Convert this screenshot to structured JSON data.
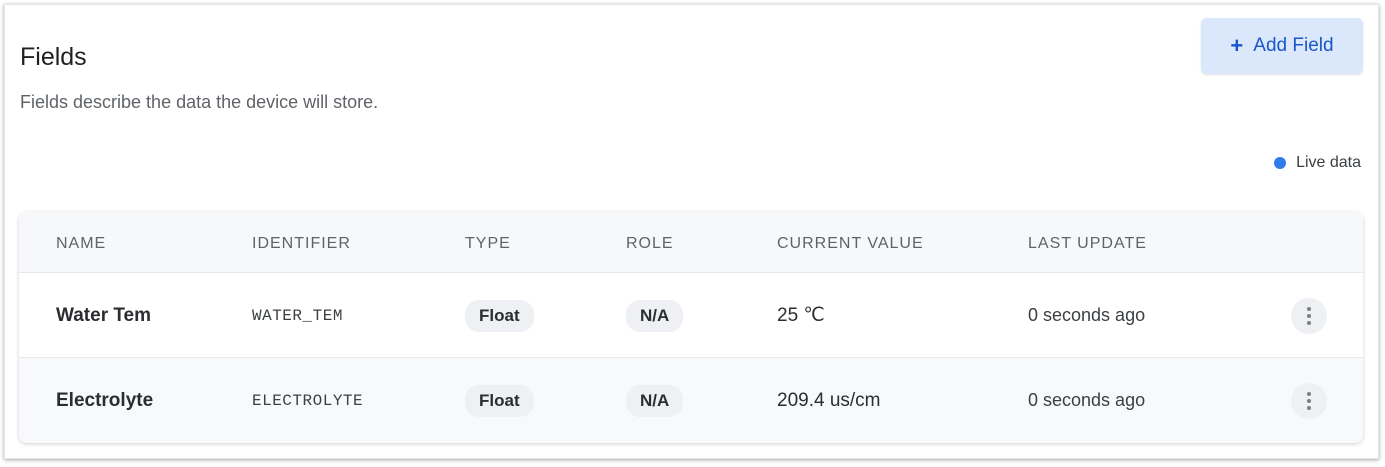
{
  "header": {
    "title": "Fields",
    "subtitle": "Fields describe the data the device will store.",
    "add_button": {
      "icon": "plus-icon",
      "label": "Add Field"
    }
  },
  "live": {
    "label": "Live data",
    "dot_color": "#2f7be8"
  },
  "table": {
    "columns": [
      "NAME",
      "IDENTIFIER",
      "TYPE",
      "ROLE",
      "CURRENT VALUE",
      "LAST UPDATE"
    ],
    "rows": [
      {
        "name": "Water Tem",
        "identifier": "WATER_TEM",
        "type": "Float",
        "role": "N/A",
        "value": "25 ℃",
        "updated": "0 seconds ago",
        "menu_icon": "more-vertical-icon"
      },
      {
        "name": "Electrolyte",
        "identifier": "ELECTROLYTE",
        "type": "Float",
        "role": "N/A",
        "value": "209.4 us/cm",
        "updated": "0 seconds ago",
        "menu_icon": "more-vertical-icon"
      }
    ]
  },
  "colors": {
    "accent": "#1a56c9",
    "accent_bg": "#dbe8fb"
  }
}
